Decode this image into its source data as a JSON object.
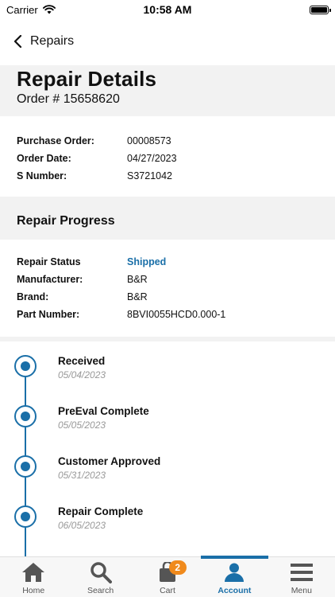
{
  "status_bar": {
    "carrier": "Carrier",
    "time": "10:58 AM"
  },
  "nav": {
    "back_label": "Repairs"
  },
  "header": {
    "title": "Repair Details",
    "order_line": "Order # 15658620"
  },
  "order_info": [
    {
      "label": "Purchase Order:",
      "value": "00008573"
    },
    {
      "label": "Order Date:",
      "value": "04/27/2023"
    },
    {
      "label": "S Number:",
      "value": "S3721042"
    }
  ],
  "progress_section": {
    "title": "Repair Progress"
  },
  "repair_info": [
    {
      "label": "Repair Status",
      "value": "Shipped"
    },
    {
      "label": "Manufacturer:",
      "value": "B&R"
    },
    {
      "label": "Brand:",
      "value": "B&R"
    },
    {
      "label": "Part Number:",
      "value": "8BVI0055HCD0.000-1"
    }
  ],
  "timeline": [
    {
      "title": "Received",
      "date": "05/04/2023"
    },
    {
      "title": "PreEval Complete",
      "date": "05/05/2023"
    },
    {
      "title": "Customer Approved",
      "date": "05/31/2023"
    },
    {
      "title": "Repair Complete",
      "date": "06/05/2023"
    }
  ],
  "tab_bar": {
    "tabs": [
      {
        "label": "Home",
        "icon": "home-icon"
      },
      {
        "label": "Search",
        "icon": "search-icon"
      },
      {
        "label": "Cart",
        "icon": "cart-icon",
        "badge": "2"
      },
      {
        "label": "Account",
        "icon": "account-icon",
        "active": true
      },
      {
        "label": "Menu",
        "icon": "menu-icon"
      }
    ]
  },
  "colors": {
    "accent": "#1a6fa8",
    "badge": "#f08a1c",
    "section_bg": "#f2f2f2"
  }
}
